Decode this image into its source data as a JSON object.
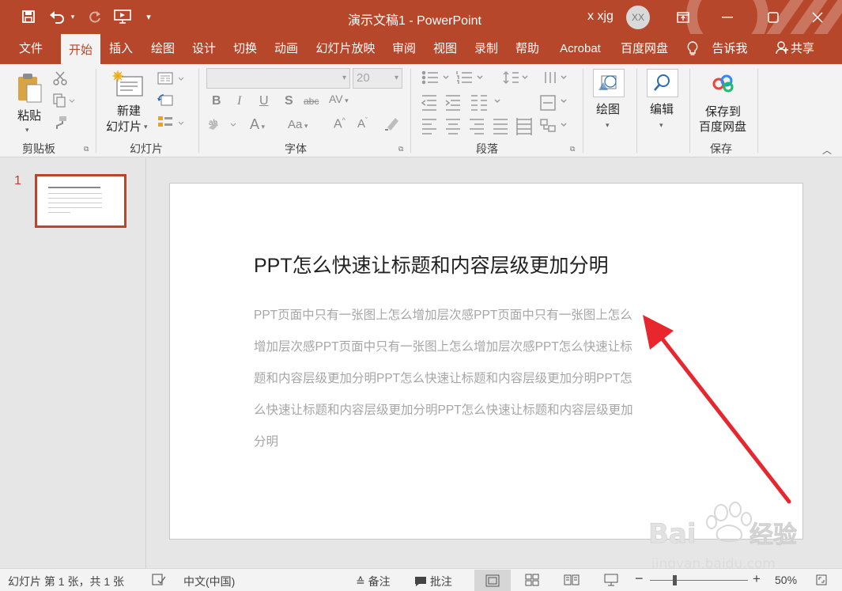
{
  "window": {
    "title": "演示文稿1  -  PowerPoint",
    "user_name": "x xjg",
    "avatar_initials": "XX"
  },
  "tabs": [
    "文件",
    "开始",
    "插入",
    "绘图",
    "设计",
    "切换",
    "动画",
    "幻灯片放映",
    "审阅",
    "视图",
    "录制",
    "帮助",
    "Acrobat",
    "百度网盘",
    "告诉我"
  ],
  "active_tab": "开始",
  "share_label": "共享",
  "ribbon": {
    "paste_label": "粘贴",
    "new_slide_line1": "新建",
    "new_slide_line2": "幻灯片",
    "font_size_value": "20",
    "draw_label": "绘图",
    "edit_label": "编辑",
    "save_baidu_line1": "保存到",
    "save_baidu_line2": "百度网盘",
    "groups": {
      "clipboard": "剪贴板",
      "slides": "幻灯片",
      "font": "字体",
      "paragraph": "段落",
      "save": "保存"
    }
  },
  "thumbnail": {
    "number": "1"
  },
  "slide": {
    "title": "PPT怎么快速让标题和内容层级更加分明",
    "body": "PPT页面中只有一张图上怎么增加层次感PPT页面中只有一张图上怎么增加层次感PPT页面中只有一张图上怎么增加层次感PPT怎么快速让标题和内容层级更加分明PPT怎么快速让标题和内容层级更加分明PPT怎么快速让标题和内容层级更加分明PPT怎么快速让标题和内容层级更加分明"
  },
  "status": {
    "slide_info": "幻灯片 第 1 张，共 1 张",
    "language": "中文(中国)",
    "notes_label": "备注",
    "comments_label": "批注",
    "zoom_level": "50%",
    "zoom_fraction": 0.25
  },
  "watermark": {
    "brand": "Bai du 经验",
    "url": "jingyan.baidu.com"
  },
  "colors": {
    "accent": "#b7472a",
    "arrow": "#e8262d"
  }
}
